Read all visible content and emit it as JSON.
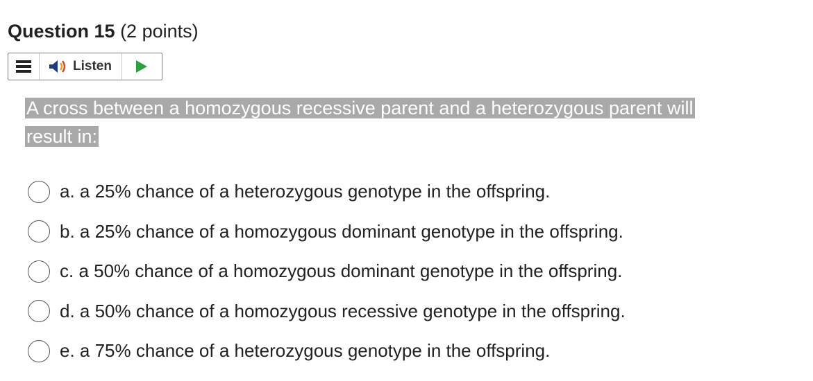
{
  "question": {
    "title": "Question 15",
    "points": "(2 points)"
  },
  "toolbar": {
    "menu_icon": "hamburger-menu-icon",
    "listen_icon": "speaker-icon",
    "listen_label": "Listen",
    "play_icon": "play-icon",
    "play_color": "#2e9e3e"
  },
  "prompt": {
    "line1": "A cross between a homozygous recessive parent and a heterozygous parent will",
    "line2": "result in:",
    "highlight_color": "#a9a9a9"
  },
  "options": [
    {
      "text": "a. a 25% chance of a heterozygous genotype in the offspring."
    },
    {
      "text": "b. a 25% chance of a homozygous dominant genotype in the offspring."
    },
    {
      "text": "c. a 50% chance of a homozygous dominant genotype in the offspring."
    },
    {
      "text": "d. a 50% chance of a homozygous recessive genotype in the offspring."
    },
    {
      "text": "e. a 75% chance of a heterozygous genotype in the offspring."
    }
  ]
}
